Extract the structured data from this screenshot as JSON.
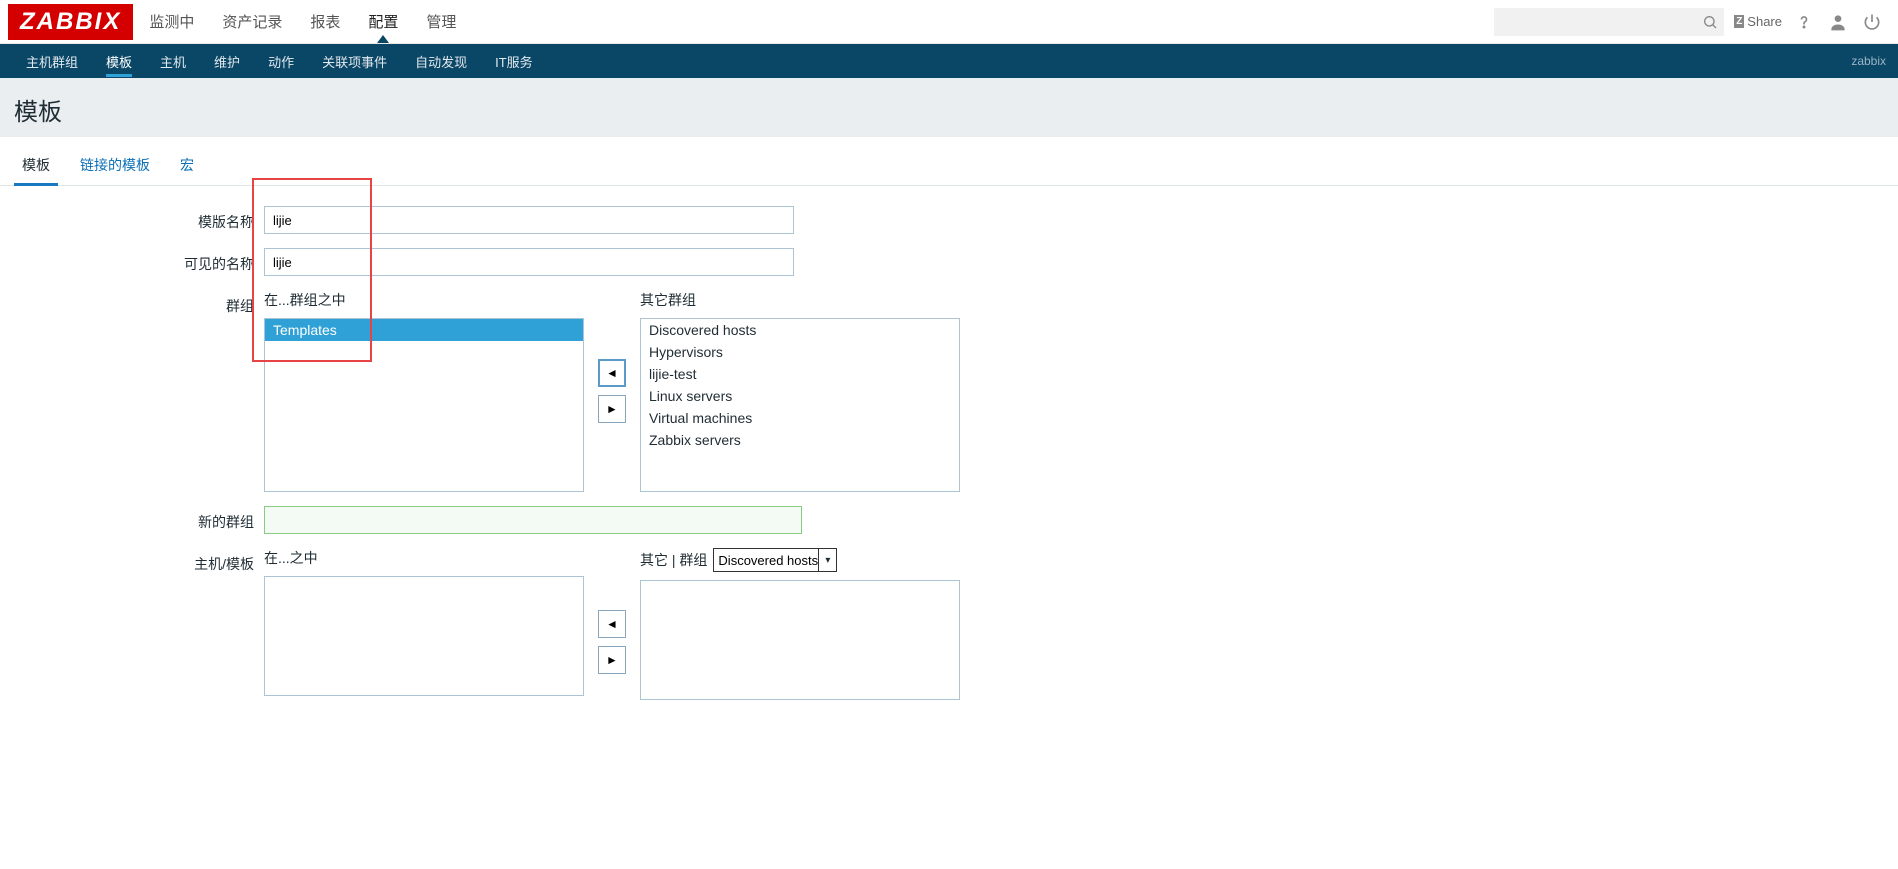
{
  "logo": "ZABBIX",
  "main_nav": {
    "items": [
      "监测中",
      "资产记录",
      "报表",
      "配置",
      "管理"
    ],
    "active_index": 3
  },
  "top_right": {
    "share_label": "Share",
    "search_placeholder": ""
  },
  "sub_nav": {
    "items": [
      "主机群组",
      "模板",
      "主机",
      "维护",
      "动作",
      "关联项事件",
      "自动发现",
      "IT服务"
    ],
    "active_index": 1,
    "right_text": "zabbix"
  },
  "page": {
    "title": "模板"
  },
  "tabs": {
    "items": [
      "模板",
      "链接的模板",
      "宏"
    ],
    "active_index": 0
  },
  "form": {
    "template_name": {
      "label": "模版名称",
      "value": "lijie"
    },
    "visible_name": {
      "label": "可见的名称",
      "value": "lijie"
    },
    "groups": {
      "label": "群组",
      "in_label": "在...群组之中",
      "other_label": "其它群组",
      "in_items": [
        "Templates"
      ],
      "in_selected_index": 0,
      "other_items": [
        "Discovered hosts",
        "Hypervisors",
        "lijie-test",
        "Linux servers",
        "Virtual machines",
        "Zabbix servers"
      ]
    },
    "new_group": {
      "label": "新的群组",
      "value": ""
    },
    "hosts": {
      "label": "主机/模板",
      "in_label": "在...之中",
      "other_prefix": "其它 | 群组",
      "dropdown_value": "Discovered hosts"
    }
  },
  "icons": {
    "left": "◄",
    "right": "►"
  }
}
